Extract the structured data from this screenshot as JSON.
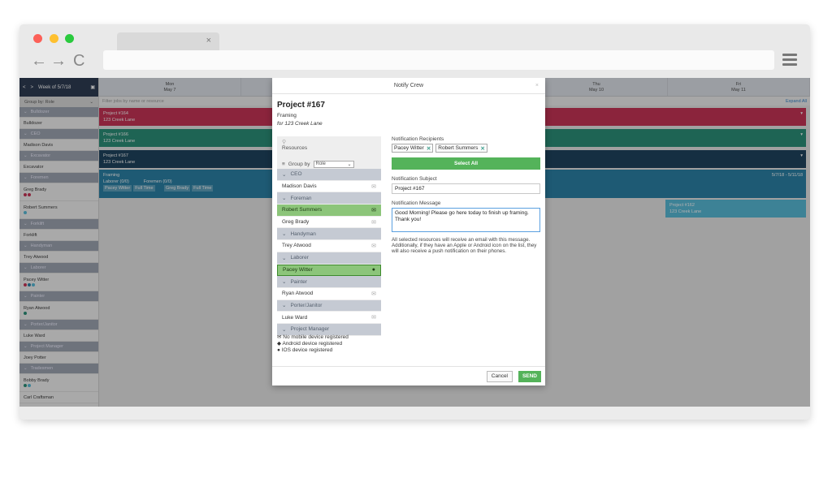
{
  "browser": {
    "tab_close": "×",
    "back": "←",
    "forward": "→",
    "reload": "C"
  },
  "sidebar": {
    "week_label": "Week of 5/7/18",
    "groupby_label": "Group by: Role",
    "rows": [
      {
        "type": "group",
        "label": "Bulldozer"
      },
      {
        "type": "res",
        "label": "Bulldozer"
      },
      {
        "type": "group",
        "label": "CEO"
      },
      {
        "type": "res",
        "label": "Madison Davis"
      },
      {
        "type": "group",
        "label": "Excavator"
      },
      {
        "type": "res",
        "label": "Excavator"
      },
      {
        "type": "group",
        "label": "Foremen"
      },
      {
        "type": "tall",
        "label": "Greg Brady",
        "dots": [
          "#c7294d",
          "#c7294d"
        ]
      },
      {
        "type": "tall",
        "label": "Robert Summers",
        "dots": [
          "#4fb8d8"
        ]
      },
      {
        "type": "group",
        "label": "Forklift"
      },
      {
        "type": "res",
        "label": "Forklift"
      },
      {
        "type": "group",
        "label": "Handyman"
      },
      {
        "type": "res",
        "label": "Trey Atwood"
      },
      {
        "type": "group",
        "label": "Laborer"
      },
      {
        "type": "tall",
        "label": "Pacey Witter",
        "dots": [
          "#c7294d",
          "#1f7ca3",
          "#4fb8d8"
        ]
      },
      {
        "type": "group",
        "label": "Painter"
      },
      {
        "type": "tall",
        "label": "Ryan Atwood",
        "dots": [
          "#1f8b72"
        ]
      },
      {
        "type": "group",
        "label": "Porter/Janitor"
      },
      {
        "type": "res",
        "label": "Luke Ward"
      },
      {
        "type": "group",
        "label": "Project Manager"
      },
      {
        "type": "res",
        "label": "Joey Potter"
      },
      {
        "type": "group",
        "label": "Tradesmen"
      },
      {
        "type": "tall",
        "label": "Bobby Brady",
        "dots": [
          "#1f8b72",
          "#4fb8d8"
        ]
      },
      {
        "type": "res",
        "label": "Carl Craftsman"
      }
    ]
  },
  "calendar": {
    "days": [
      {
        "name": "Mon",
        "date": "May 7"
      },
      {
        "name": "",
        "date": ""
      },
      {
        "name": "",
        "date": ""
      },
      {
        "name": "Thu",
        "date": "May 10"
      },
      {
        "name": "Fri",
        "date": "May 11"
      }
    ],
    "filter_placeholder": "Filter jobs by name or resource",
    "expand_all": "Expand All",
    "bars": [
      {
        "title": "Project #164",
        "addr": "123 Creek Lane"
      },
      {
        "title": "Project #166",
        "addr": "123 Creek Lane"
      },
      {
        "title": "Project #167",
        "addr": "123 Creek Lane"
      }
    ],
    "framing": {
      "title": "Framing",
      "laborer": "Laborer (0/0)",
      "foremen": "Foremen (0/0)",
      "chips": [
        "Pacey Witter",
        "Full Time",
        "Greg Brady",
        "Full Time"
      ],
      "range": "5/7/18 - 5/11/18"
    },
    "b5": {
      "title": "Project #162",
      "addr": "123 Creek Lane"
    }
  },
  "modal": {
    "title": "Notify Crew",
    "close": "×",
    "project": "Project #167",
    "phase": "Framing",
    "address": "for 123 Creek Lane",
    "resources_label": "Resources",
    "groupby_label": "Group by",
    "groupby_value": "Role",
    "list": [
      {
        "type": "grp",
        "label": "CEO"
      },
      {
        "type": "res",
        "label": "Madison Davis",
        "icon": "✉"
      },
      {
        "type": "grp",
        "label": "Foreman"
      },
      {
        "type": "sel",
        "label": "Robert Summers",
        "icon": "✉"
      },
      {
        "type": "res",
        "label": "Greg Brady",
        "icon": "✉"
      },
      {
        "type": "grp",
        "label": "Handyman"
      },
      {
        "type": "res",
        "label": "Trey Atwood",
        "icon": "✉"
      },
      {
        "type": "grp",
        "label": "Laborer"
      },
      {
        "type": "sel2",
        "label": "Pacey Witter",
        "icon": ""
      },
      {
        "type": "grp",
        "label": "Painter"
      },
      {
        "type": "res",
        "label": "Ryan Atwood",
        "icon": "✉"
      },
      {
        "type": "grp",
        "label": "Porter/Janitor"
      },
      {
        "type": "res",
        "label": "Luke Ward",
        "icon": "✉"
      },
      {
        "type": "grp",
        "label": "Project Manager"
      }
    ],
    "legend": [
      "No mobile device registered",
      "Android device registered",
      "IOS device registered"
    ],
    "recipients_label": "Notification Recipients",
    "recipients": [
      "Pacey Witter",
      "Robert Summers"
    ],
    "select_all": "Select All",
    "subject_label": "Notification Subject",
    "subject_value": "Project #167",
    "message_label": "Notification Message",
    "message_value": "Good Morning! Please go here today to finish up framing.  Thank you!",
    "info_text": "All selected resources will receive an email with this message. Additionally, if they have an Apple or Android icon on the list, they will also receive a push notification on their phones.",
    "cancel": "Cancel",
    "send": "SEND"
  }
}
